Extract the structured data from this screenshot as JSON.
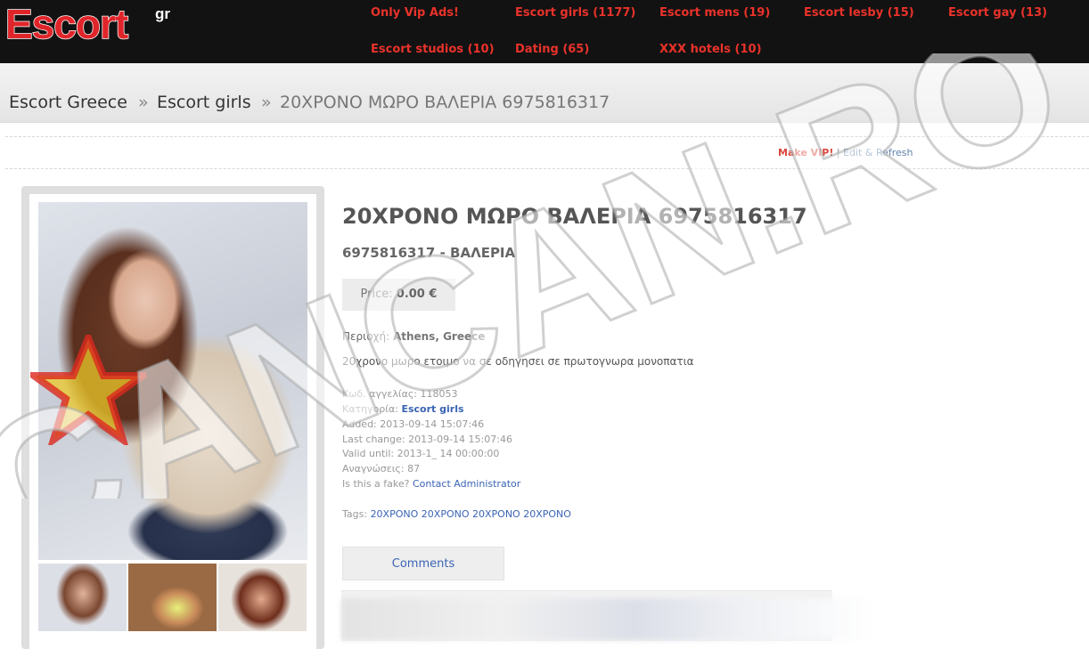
{
  "logo": {
    "main": "Escort",
    "sup": "gr"
  },
  "nav": [
    {
      "label": "Only Vip Ads!"
    },
    {
      "label": "Escort girls (1177)"
    },
    {
      "label": "Escort mens (19)"
    },
    {
      "label": "Escort lesby (15)"
    },
    {
      "label": "Escort gay (13)"
    },
    {
      "label": "Escort studios (10)"
    },
    {
      "label": "Dating (65)"
    },
    {
      "label": "XXX hotels (10)"
    }
  ],
  "breadcrumb": {
    "home": "Escort Greece",
    "category": "Escort girls",
    "current": "20ΧΡΟΝΟ ΜΩΡΟ ΒΑΛΕΡΙΑ 6975816317",
    "separator": "»"
  },
  "actions": {
    "vip": "Make VIP!",
    "divider": "|",
    "edit": "Edit & Refresh"
  },
  "ad": {
    "title": "20ΧΡΟΝΟ ΜΩΡΟ ΒΑΛΕΡΙΑ 6975816317",
    "subtitle": "6975816317 - ΒΑΛΕΡΙΑ",
    "price_label": "Price:",
    "price_value": "0.00 €",
    "region_label": "Περιοχή:",
    "region_value": "Athens, Greece",
    "description": "20χρονο μωρο ετοιμο να σε οδηγησει σε πρωτογνωρα μονοπατια",
    "code_label": "Κωδ. αγγελίας:",
    "code_value": "118053",
    "category_label": "Κατηγορία:",
    "category_value": "Escort girls",
    "added_label": "Added:",
    "added_value": "2013-09-14 15:07:46",
    "changed_label": "Last change:",
    "changed_value": "2013-09-14 15:07:46",
    "valid_label": "Valid until:",
    "valid_value": "2013-1_ 14 00:00:00",
    "views_label": "Αναγνώσεις:",
    "views_value": "87",
    "fake_label": "Is this a fake?",
    "fake_link": "Contact Administrator",
    "tags_label": "Tags:",
    "tags": [
      "20ΧΡΟΝΟ",
      "20ΧΡΟΝΟ",
      "20ΧΡΟΝΟ",
      "20ΧΡΟΝΟ"
    ]
  },
  "comments_button": "Comments",
  "watermark": "CANCAN.RO",
  "colors": {
    "brand_red": "#e0252a",
    "nav_red": "#e9322a",
    "link_blue": "#3b64b5",
    "header_bg": "#121212"
  }
}
